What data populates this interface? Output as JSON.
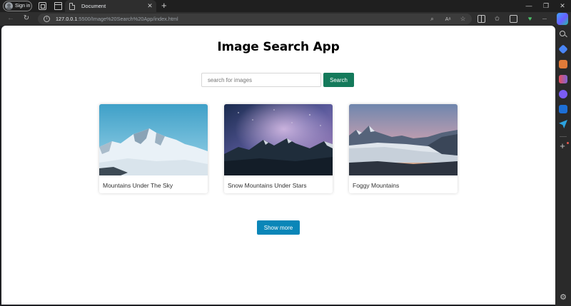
{
  "browser": {
    "sign_in_label": "Sign in",
    "tab_title": "Document",
    "url_host": "127.0.0.1",
    "url_path": ":5500/Image%20Search%20App/index.html"
  },
  "page": {
    "title": "Image Search App",
    "search": {
      "placeholder": "search for images",
      "value": "",
      "button_label": "Search"
    },
    "results": [
      {
        "caption": "Mountains Under The Sky"
      },
      {
        "caption": "Snow Mountains Under Stars"
      },
      {
        "caption": "Foggy Mountains"
      }
    ],
    "show_more_label": "Show more"
  },
  "colors": {
    "search_button": "#147a5b",
    "show_more_button": "#0a86b8"
  }
}
